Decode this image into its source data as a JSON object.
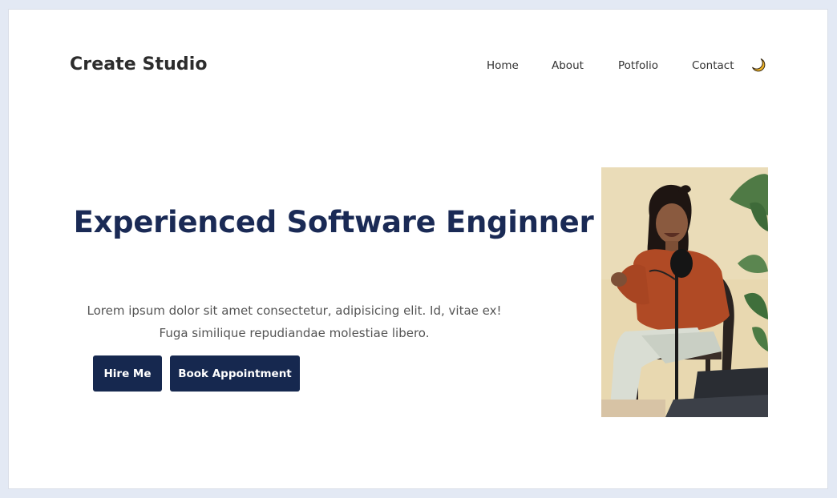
{
  "header": {
    "brand": "Create Studio",
    "nav": [
      "Home",
      "About",
      "Potfolio",
      "Contact"
    ],
    "theme_toggle_icon": "moon-icon"
  },
  "hero": {
    "headline": "Experienced Software Enginner",
    "description_line1": "Lorem ipsum dolor sit amet consectetur, adipisicing elit. Id, vitae ex!",
    "description_line2": "Fuga similique repudiandae molestiae libero.",
    "buttons": {
      "hire": "Hire Me",
      "book": "Book Appointment"
    },
    "image_icon": "podcaster-photo"
  },
  "colors": {
    "page_bg": "#e3e9f4",
    "card_bg": "#ffffff",
    "primary": "#16284f",
    "headline": "#1a2a55",
    "moon": "#f2b72a"
  }
}
